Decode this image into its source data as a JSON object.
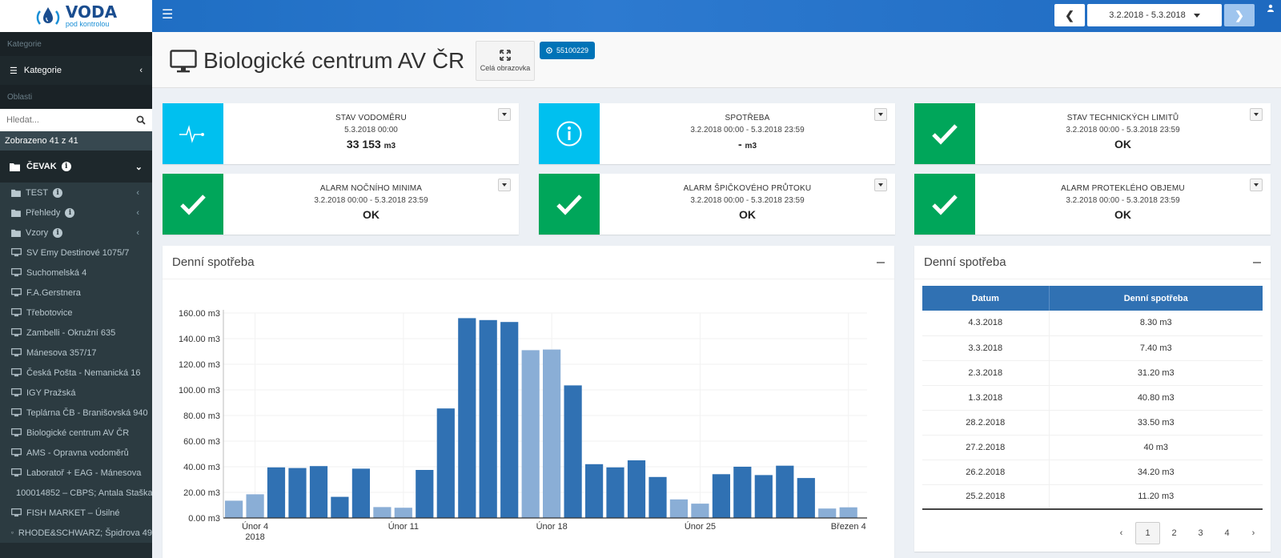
{
  "logo": {
    "main": "VODA",
    "sub": "pod kontrolou"
  },
  "topbar": {
    "prev_icon": "chevron-left-icon",
    "date_range": "3.2.2018 - 5.3.2018",
    "next_icon": "chevron-right-icon"
  },
  "sidebar": {
    "section_kategorie": "Kategorie",
    "kategorie_label": "Kategorie",
    "section_oblasti": "Oblasti",
    "search_placeholder": "Hledat...",
    "count_text": "Zobrazeno 41 z 41",
    "cevak_label": "ČEVAK",
    "folders": [
      {
        "label": "TEST"
      },
      {
        "label": "Přehledy"
      },
      {
        "label": "Vzory"
      }
    ],
    "items": [
      {
        "label": "SV Emy Destinové 1075/7"
      },
      {
        "label": "Suchomelská 4"
      },
      {
        "label": "F.A.Gerstnera"
      },
      {
        "label": "Třebotovice"
      },
      {
        "label": "Zambelli - Okružní 635"
      },
      {
        "label": "Mánesova 357/17"
      },
      {
        "label": "Česká Pošta - Nemanická 16"
      },
      {
        "label": "IGY Pražská"
      },
      {
        "label": "Teplárna ČB - Branišovská 940"
      },
      {
        "label": "Biologické centrum AV ČR"
      },
      {
        "label": "AMS - Opravna vodoměrů"
      },
      {
        "label": "Laboratoř + EAG - Mánesova"
      },
      {
        "label": "100014852 – CBPS; Antala Staška"
      },
      {
        "label": "FISH MARKET – Úsilné"
      },
      {
        "label": "RHODE&SCHWARZ; Špidrova 49"
      }
    ]
  },
  "header": {
    "title": "Biologické centrum AV ČR",
    "fullscreen_label": "Celá obrazovka",
    "meter_id": "55100229"
  },
  "cards": [
    {
      "title": "STAV VODOMĚRU",
      "sub": "5.3.2018 00:00",
      "value": "33 153",
      "unit": "m3"
    },
    {
      "title": "SPOTŘEBA",
      "sub": "3.2.2018 00:00 - 5.3.2018 23:59",
      "value": "-",
      "unit": "m3"
    },
    {
      "title": "STAV TECHNICKÝCH LIMITŮ",
      "sub": "3.2.2018 00:00 - 5.3.2018 23:59",
      "value": "OK",
      "unit": ""
    },
    {
      "title": "ALARM NOČNÍHO MINIMA",
      "sub": "3.2.2018 00:00 - 5.3.2018 23:59",
      "value": "OK",
      "unit": ""
    },
    {
      "title": "ALARM ŠPIČKOVÉHO PRŮTOKU",
      "sub": "3.2.2018 00:00 - 5.3.2018 23:59",
      "value": "OK",
      "unit": ""
    },
    {
      "title": "ALARM PROTEKLÉHO OBJEMU",
      "sub": "3.2.2018 00:00 - 5.3.2018 23:59",
      "value": "OK",
      "unit": ""
    }
  ],
  "colors": {
    "dark_bar": "#3071b3",
    "light_bar": "#8aaed6",
    "cyan": "#00c0ef",
    "green": "#00a65a"
  },
  "chart_box": {
    "title": "Denní spotřeba"
  },
  "chart_data": {
    "type": "bar",
    "title": "",
    "xlabel": "",
    "ylabel": "",
    "ylim": [
      0,
      160
    ],
    "yticks": [
      "0.00 m3",
      "20.00 m3",
      "40.00 m3",
      "60.00 m3",
      "80.00 m3",
      "100.00 m3",
      "120.00 m3",
      "140.00 m3",
      "160.00 m3"
    ],
    "xticks": [
      {
        "label": "Únor 4",
        "sub": "2018"
      },
      {
        "label": "Únor 11",
        "sub": ""
      },
      {
        "label": "Únor 18",
        "sub": ""
      },
      {
        "label": "Únor 25",
        "sub": ""
      },
      {
        "label": "Březen 4",
        "sub": ""
      }
    ],
    "dates": [
      "3.2.2018",
      "4.2.2018",
      "5.2.2018",
      "6.2.2018",
      "7.2.2018",
      "8.2.2018",
      "9.2.2018",
      "10.2.2018",
      "11.2.2018",
      "12.2.2018",
      "13.2.2018",
      "14.2.2018",
      "15.2.2018",
      "16.2.2018",
      "17.2.2018",
      "18.2.2018",
      "19.2.2018",
      "20.2.2018",
      "21.2.2018",
      "22.2.2018",
      "23.2.2018",
      "24.2.2018",
      "25.2.2018",
      "26.2.2018",
      "27.2.2018",
      "28.2.2018",
      "1.3.2018",
      "2.3.2018",
      "3.3.2018",
      "4.3.2018"
    ],
    "values": [
      13.5,
      18.5,
      39.5,
      39.0,
      40.5,
      16.5,
      38.5,
      8.5,
      8.0,
      37.5,
      85.5,
      156.0,
      154.5,
      153.0,
      131.0,
      131.5,
      103.5,
      42.0,
      39.5,
      45.0,
      32.0,
      14.5,
      11.2,
      34.2,
      40.0,
      33.5,
      40.8,
      31.2,
      7.4,
      8.3
    ],
    "weekend": [
      true,
      true,
      false,
      false,
      false,
      false,
      false,
      true,
      true,
      false,
      false,
      false,
      false,
      false,
      true,
      true,
      false,
      false,
      false,
      false,
      false,
      true,
      true,
      false,
      false,
      false,
      false,
      false,
      true,
      true
    ]
  },
  "table_box": {
    "title": "Denní spotřeba",
    "headers": [
      "Datum",
      "Denní spotřeba"
    ],
    "rows": [
      [
        "4.3.2018",
        "8.30 m3"
      ],
      [
        "3.3.2018",
        "7.40 m3"
      ],
      [
        "2.3.2018",
        "31.20 m3"
      ],
      [
        "1.3.2018",
        "40.80 m3"
      ],
      [
        "28.2.2018",
        "33.50 m3"
      ],
      [
        "27.2.2018",
        "40 m3"
      ],
      [
        "26.2.2018",
        "34.20 m3"
      ],
      [
        "25.2.2018",
        "11.20 m3"
      ]
    ],
    "pages": [
      "1",
      "2",
      "3",
      "4"
    ],
    "current_page": "1"
  }
}
